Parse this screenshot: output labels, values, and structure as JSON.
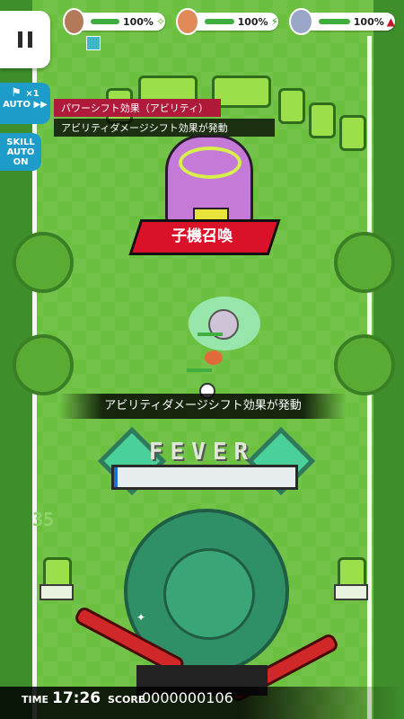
{
  "hud": {
    "pause_icon": "pause-icon",
    "party": [
      {
        "hp": "100%",
        "avatar_color": "#b37a5a",
        "bar_color": "#3fae3f",
        "icon": "✧"
      },
      {
        "hp": "100%",
        "avatar_color": "#e08a5a",
        "bar_color": "#3fae3f",
        "icon": "⚡"
      },
      {
        "hp": "100%",
        "avatar_color": "#9aa6c8",
        "bar_color": "#3fae3f",
        "icon": "▲"
      }
    ],
    "auto": {
      "label": "AUTO ▶▶",
      "multiplier": "×1"
    },
    "skill": {
      "line1": "SKILL",
      "line2": "AUTO",
      "line3": "ON"
    }
  },
  "buffs": {
    "power_shift": "パワーシフト効果（アビリティ）",
    "ability_damage": "アビリティダメージシフト効果が発動"
  },
  "enemy": {
    "summon_label": "子機召喚"
  },
  "messages": {
    "ability_msg": "アビリティダメージシフト効果が発動"
  },
  "fever": {
    "label": "FEVER",
    "gauge_fraction": 0.02
  },
  "counter": "35",
  "footer": {
    "time_label": "TIME",
    "time_value": "17:26",
    "score_label": "SCORE",
    "score_value": "0000000106"
  },
  "colors": {
    "field": "#6cc040",
    "accent_blue": "#1d9bc9",
    "summon_red": "#d9122a"
  }
}
